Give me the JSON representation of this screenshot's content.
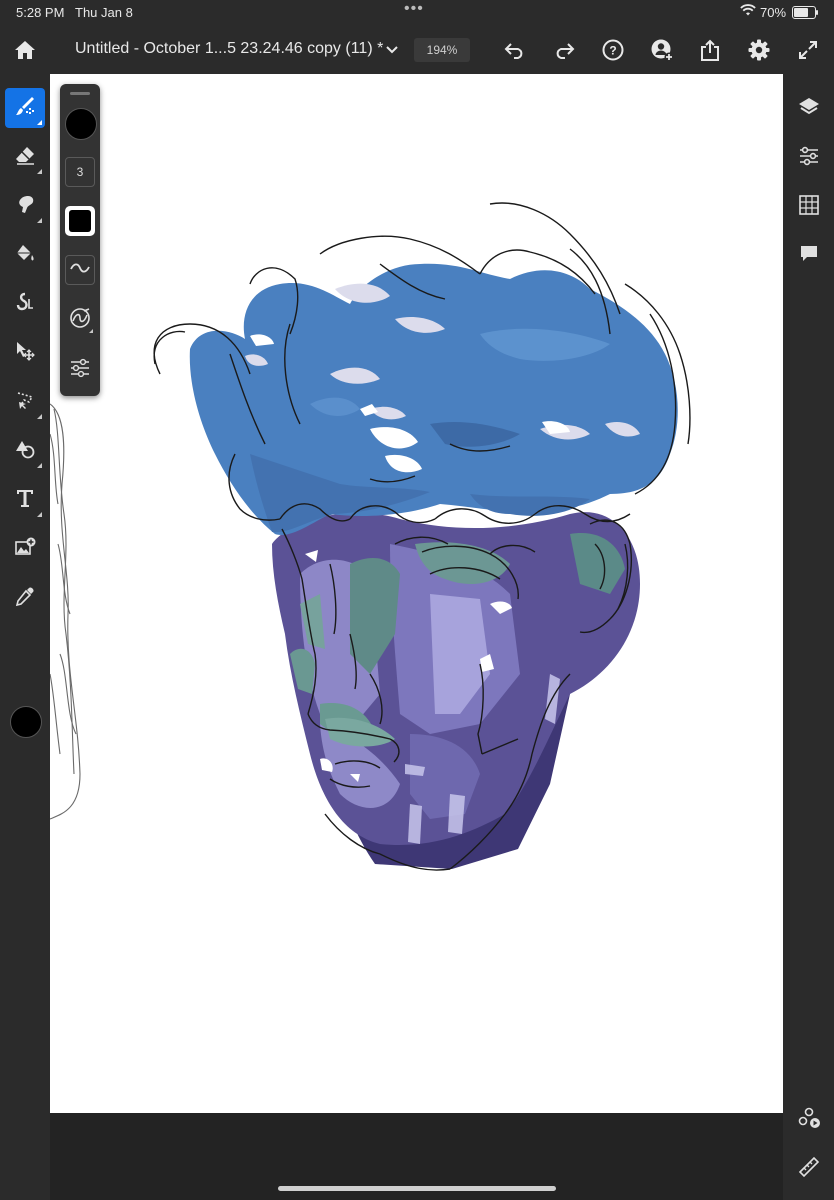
{
  "status_bar": {
    "time": "5:28 PM",
    "date": "Thu Jan 8",
    "multitask_dots": "•••",
    "battery_percent": "70%",
    "battery_level": 0.7
  },
  "app_bar": {
    "document_title": "Untitled - October 1...5 23.24.46 copy (11) *",
    "zoom": "194%",
    "icons": [
      "home-icon",
      "chevron-down-icon",
      "undo-icon",
      "redo-icon",
      "help-icon",
      "invite-icon",
      "share-icon",
      "settings-icon",
      "fullscreen-icon"
    ]
  },
  "left_toolbar": {
    "tools": [
      "brush",
      "eraser",
      "smudge",
      "fill",
      "liquify",
      "move",
      "lasso",
      "shape",
      "type",
      "place-image",
      "eyedropper"
    ],
    "active_tool": "brush",
    "color": "#000000"
  },
  "brush_panel": {
    "brush_size": "3",
    "opacity_color": "#000000"
  },
  "right_toolbar": {
    "icons": [
      "layers-icon",
      "properties-icon",
      "grid-icon",
      "comments-icon",
      "livestream-icon",
      "ruler-icon"
    ]
  },
  "colors": {
    "accent": "#1473e6",
    "chrome": "#2b2b2b",
    "canvas": "#ffffff",
    "hair": "#4a80c0",
    "face": "#5b5296"
  }
}
